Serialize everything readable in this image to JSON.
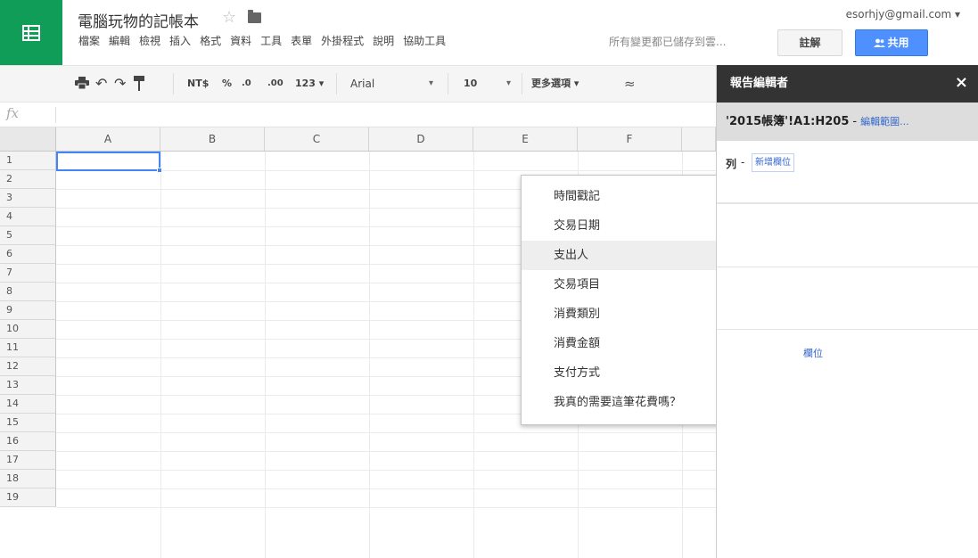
{
  "header": {
    "doc_title": "電腦玩物的記帳本",
    "user_email": "esorhjy@gmail.com ▾",
    "save_status": "所有變更都已儲存到雲...",
    "comment_label": "註解",
    "share_label": "共用",
    "menu": [
      "檔案",
      "編輯",
      "檢視",
      "插入",
      "格式",
      "資料",
      "工具",
      "表單",
      "外掛程式",
      "說明",
      "協助工具"
    ]
  },
  "toolbar": {
    "currency": "NT$",
    "percent": "%",
    "dec_decrease": ".0",
    "dec_increase": ".00",
    "number_format": "123 ▾",
    "font": "Arial",
    "font_caret": "▾",
    "font_size": "10",
    "size_caret": "▾",
    "more": "更多選項 ▾",
    "collapse": "≈"
  },
  "formula_bar": {
    "label": "fx"
  },
  "grid": {
    "columns": [
      "A",
      "B",
      "C",
      "D",
      "E",
      "F"
    ],
    "rows": [
      "1",
      "2",
      "3",
      "4",
      "5",
      "6",
      "7",
      "8",
      "9",
      "10",
      "11",
      "12",
      "13",
      "14",
      "15",
      "16",
      "17",
      "18",
      "19"
    ]
  },
  "dropdown": {
    "items": [
      "時間戳記",
      "交易日期",
      "支出人",
      "交易項目",
      "消費類別",
      "消費金額",
      "支付方式",
      "我真的需要這筆花費嗎？"
    ],
    "highlighted_index": 2
  },
  "panel": {
    "title": "報告編輯者",
    "close": "×",
    "range": "'2015帳簿'!A1:H205",
    "range_sep": "-",
    "range_edit": "編輯範圍...",
    "rows_label": "列",
    "rows_dash": "-",
    "add_field": "新增欄位",
    "partial_field_text": "欄位"
  },
  "colors": {
    "brand_green": "#0f9d58",
    "share_blue": "#4d90fe",
    "selection_blue": "#4285f4",
    "panel_header": "#333333"
  }
}
